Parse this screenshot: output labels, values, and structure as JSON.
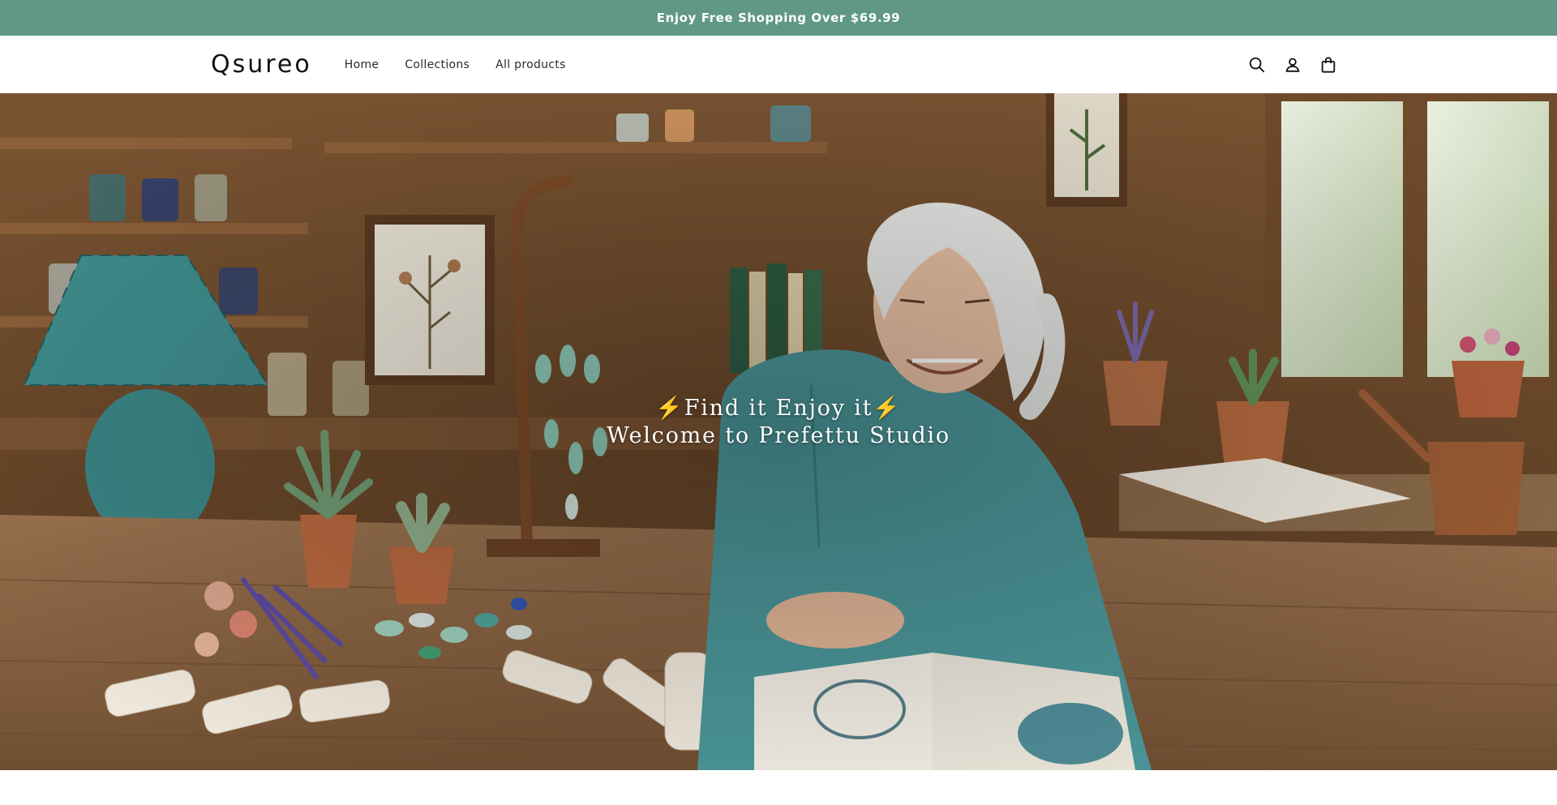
{
  "announcement": {
    "text": "Enjoy Free Shopping Over $69.99"
  },
  "header": {
    "logo": "Qsureo",
    "nav": [
      {
        "label": "Home"
      },
      {
        "label": "Collections"
      },
      {
        "label": "All products"
      }
    ],
    "icons": [
      "search-icon",
      "account-icon",
      "cart-icon"
    ]
  },
  "hero": {
    "line1": "⚡Find it Enjoy it⚡",
    "line2": "Welcome to Prefettu Studio"
  },
  "colors": {
    "announcement_bg": "#609885",
    "announcement_text": "#ffffff",
    "header_bg": "#ffffff",
    "hero_text": "#ffffff"
  }
}
